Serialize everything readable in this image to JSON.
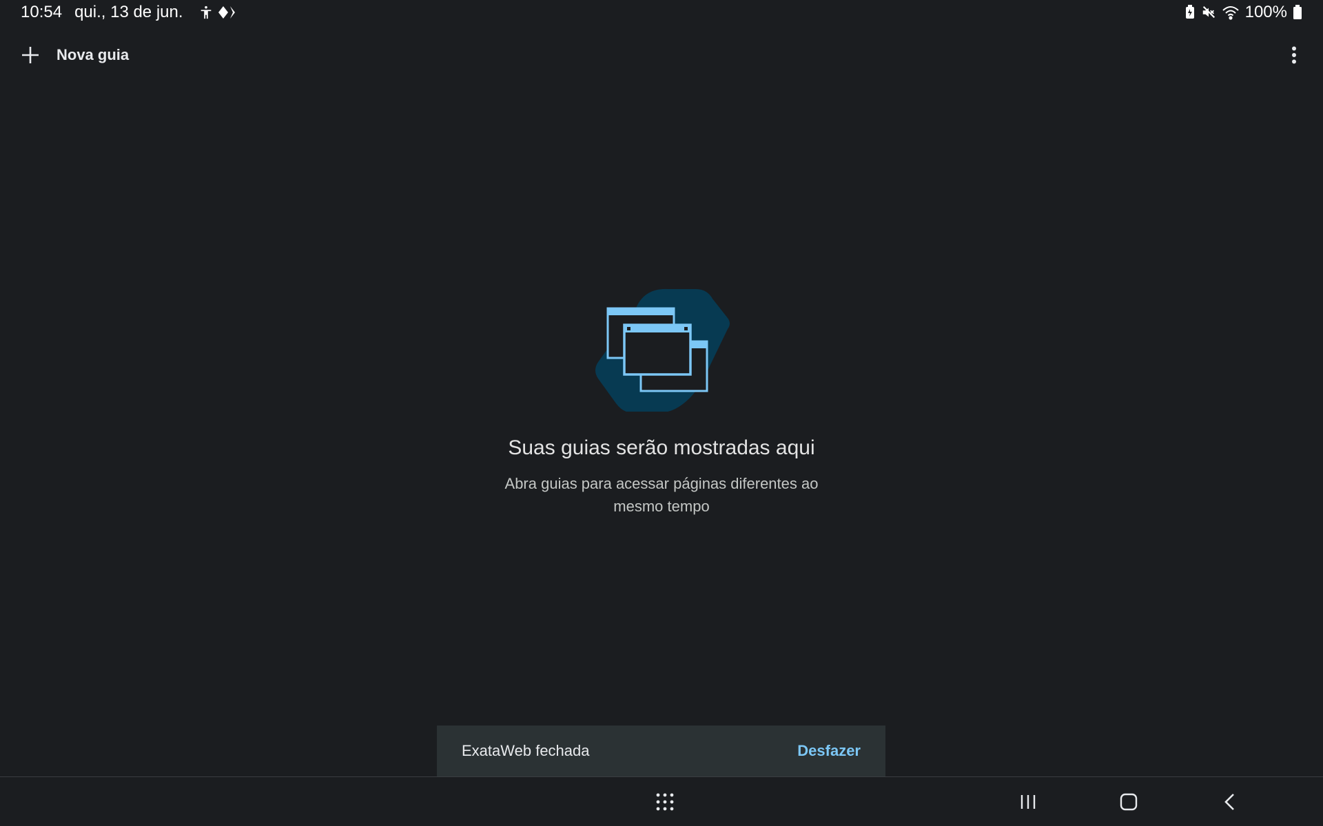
{
  "status_bar": {
    "time": "10:54",
    "date": "qui., 13 de jun.",
    "battery_percent": "100%",
    "icons_left": [
      "accessibility-icon",
      "diamond-icon"
    ],
    "icons_right": [
      "battery-saver-icon",
      "mute-icon",
      "wifi-icon",
      "battery-icon"
    ]
  },
  "toolbar": {
    "new_tab_label": "Nova guia",
    "new_tab_icon": "plus-icon",
    "menu_icon": "more-vert-icon"
  },
  "empty_state": {
    "title": "Suas guias serão mostradas aqui",
    "subtitle": "Abra guias para acessar páginas diferentes ao mesmo tempo",
    "illustration_icon": "tabs-illustration"
  },
  "snackbar": {
    "message": "ExataWeb fechada",
    "action_label": "Desfazer"
  },
  "nav_bar": {
    "icons": [
      "app-drawer-icon",
      "recents-icon",
      "home-icon",
      "back-icon"
    ]
  },
  "colors": {
    "background": "#1b1d20",
    "accent": "#7cc7f6",
    "snackbar_bg": "#2b3234",
    "illustration_bg": "#073a52"
  }
}
